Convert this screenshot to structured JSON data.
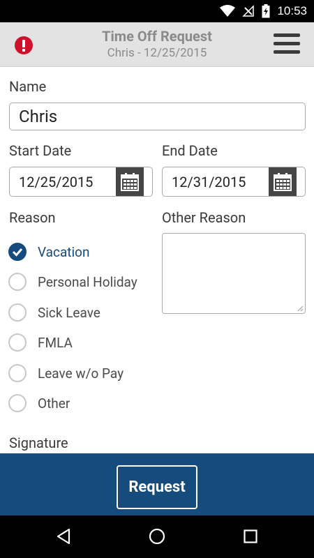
{
  "status_bar": {
    "time": "10:53"
  },
  "header": {
    "title": "Time Off Request",
    "subtitle": "Chris - 12/25/2015"
  },
  "form": {
    "name_label": "Name",
    "name_value": "Chris",
    "start_date_label": "Start Date",
    "start_date_value": "12/25/2015",
    "end_date_label": "End Date",
    "end_date_value": "12/31/2015",
    "reason_label": "Reason",
    "other_reason_label": "Other Reason",
    "other_reason_value": "",
    "reasons": [
      {
        "label": "Vacation",
        "checked": true
      },
      {
        "label": "Personal Holiday",
        "checked": false
      },
      {
        "label": "Sick Leave",
        "checked": false
      },
      {
        "label": "FMLA",
        "checked": false
      },
      {
        "label": "Leave w/o Pay",
        "checked": false
      },
      {
        "label": "Other",
        "checked": false
      }
    ],
    "signature_label": "Signature"
  },
  "footer": {
    "request_label": "Request"
  },
  "colors": {
    "accent": "#154b7d",
    "header_bg": "#e3e3e3",
    "alert": "#d0112b"
  }
}
